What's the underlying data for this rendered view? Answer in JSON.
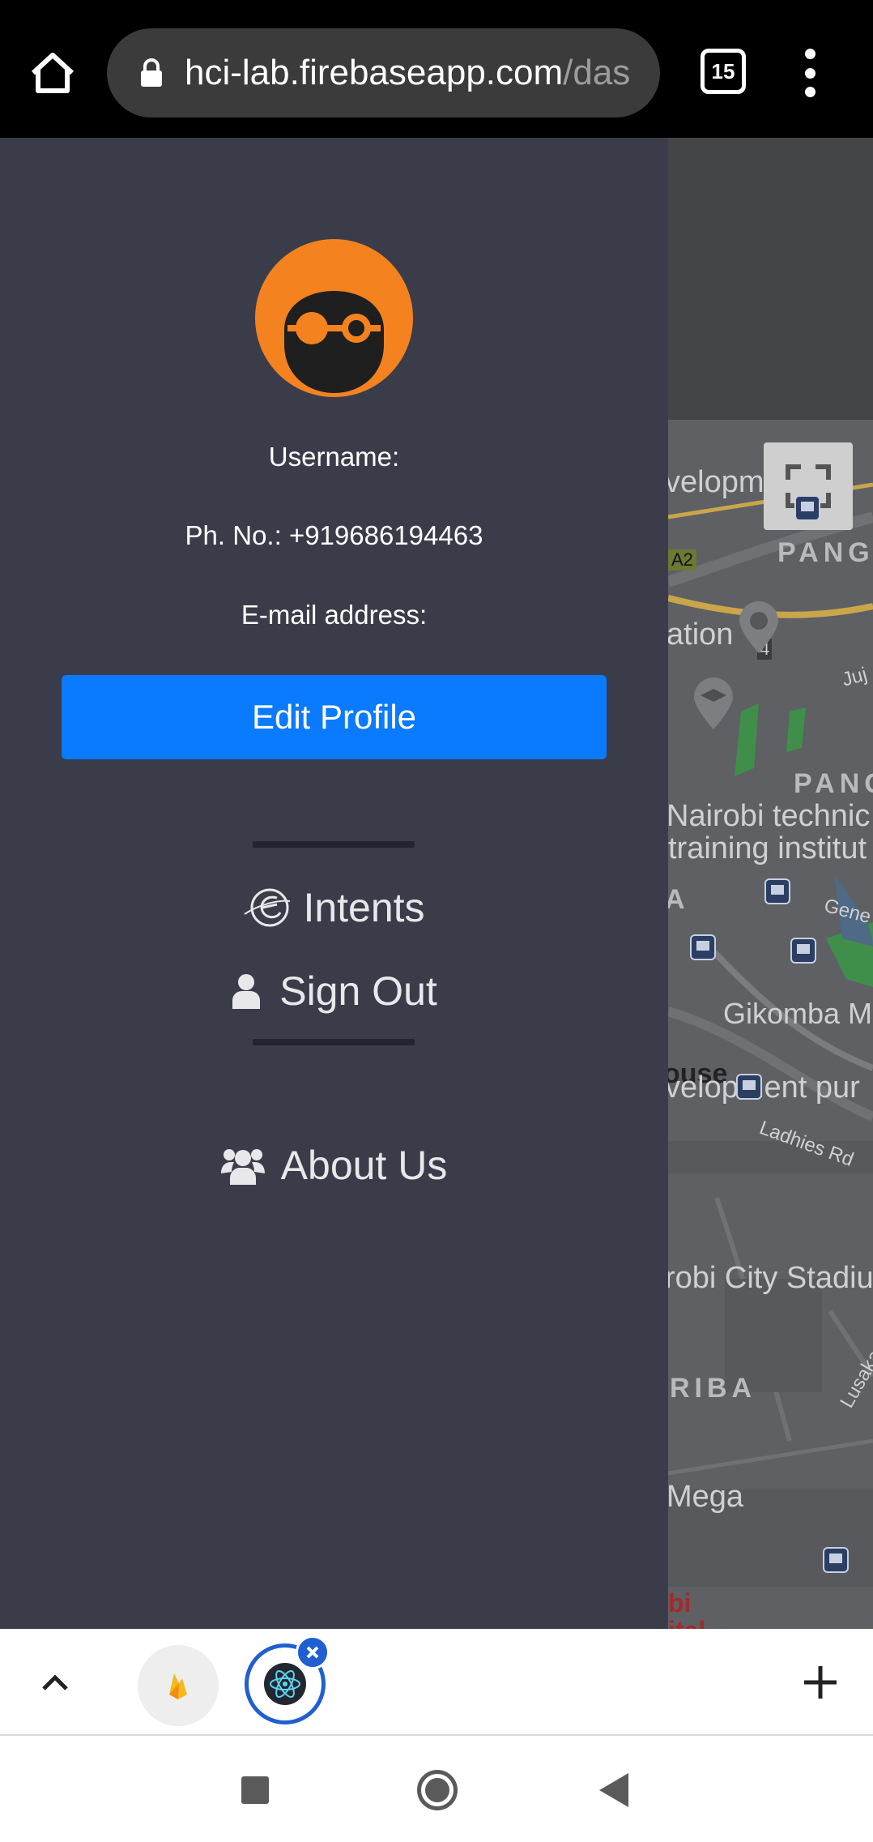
{
  "browser": {
    "url_main": "hci-lab.firebaseapp.com",
    "url_faded": "/das",
    "tab_count": "15"
  },
  "profile": {
    "username_label": "Username:",
    "phone_label": "Ph. No.: +919686194463",
    "email_label": "E-mail address:",
    "edit_button": "Edit Profile"
  },
  "nav": {
    "intents": "Intents",
    "sign_out": "Sign Out",
    "about_us": "About Us"
  },
  "map": {
    "labels": {
      "l1": "velopm",
      "l2": "PANG",
      "l3": "ation",
      "l4": "Nairobi technic",
      "l5": "training institut",
      "l6": "PANG",
      "l7": "Gikomba M",
      "l8": "velopment pur",
      "l9": "Ladhies Rd",
      "l10": "robi City Stadiu",
      "l11": "RIBA",
      "l12": "Mega",
      "l13": "A",
      "l14": "Gene",
      "l15": "Juj",
      "l16": "ouse",
      "l17": "A2",
      "l18": "4",
      "l19": "Lusaka",
      "l20": "bi",
      "l21": "ital"
    },
    "accent": "#2f5fa8"
  },
  "colors": {
    "drawer_bg": "#3a3d49",
    "button_blue": "#0a7aff",
    "avatar_orange": "#f4821f"
  },
  "icons": {
    "home": "home-icon",
    "lock": "lock-icon",
    "menu": "more-vert-icon",
    "intents": "intents-logo-icon",
    "sign_out": "user-icon",
    "about": "users-icon",
    "fullscreen": "fullscreen-icon"
  }
}
